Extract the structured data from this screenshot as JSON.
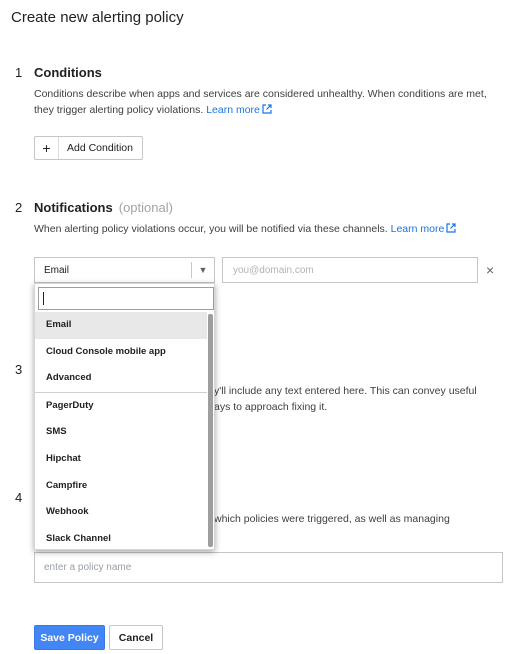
{
  "page": {
    "title": "Create new alerting policy"
  },
  "conditions": {
    "number": "1",
    "heading": "Conditions",
    "description": "Conditions describe when apps and services are considered unhealthy. When conditions are met, they trigger alerting policy violations.",
    "learn_more": "Learn more",
    "add_button_icon": "+",
    "add_button_label": "Add Condition"
  },
  "notifications": {
    "number": "2",
    "heading": "Notifications",
    "optional": "(optional)",
    "description": "When alerting policy violations occur, you will be notified via these channels.",
    "learn_more": "Learn more",
    "channel_selected": "Email",
    "email_placeholder": "you@domain.com",
    "remove_icon": "×"
  },
  "dropdown": {
    "items_top": [
      "Email",
      "Cloud Console mobile app",
      "Advanced"
    ],
    "items_bottom": [
      "PagerDuty",
      "SMS",
      "Hipchat",
      "Campfire",
      "Webhook",
      "Slack Channel"
    ]
  },
  "documentation": {
    "number": "3",
    "partial_line1": "y'll include any text entered here. This can convey useful",
    "partial_line2": "ays to approach fixing it."
  },
  "name_section": {
    "number": "4",
    "partial_line1": "which policies were triggered, as well as managing",
    "policy_name_placeholder": "enter a policy name"
  },
  "footer": {
    "save_label": "Save Policy",
    "cancel_label": "Cancel"
  },
  "colors": {
    "accent": "#4285f4",
    "link": "#1a73e8"
  }
}
